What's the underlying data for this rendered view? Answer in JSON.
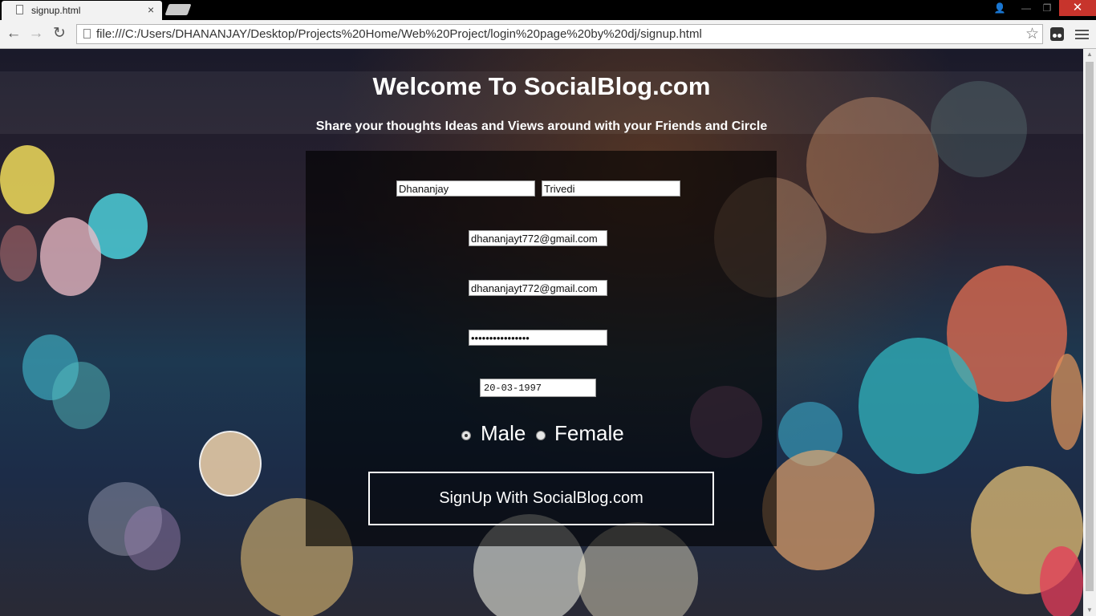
{
  "browser": {
    "tab_title": "signup.html",
    "tab_close": "×",
    "url": "file:///C:/Users/DHANANJAY/Desktop/Projects%20Home/Web%20Project/login%20page%20by%20dj/signup.html",
    "back": "←",
    "forward": "→",
    "reload": "↻",
    "star": "☆",
    "win_user": "👤",
    "win_min": "—",
    "win_max": "❐",
    "win_close": "✕"
  },
  "page": {
    "welcome": "Welcome To SocialBlog.com",
    "subtitle": "Share your thoughts Ideas and Views around with your Friends and Circle",
    "form": {
      "first_name": "Dhananjay",
      "last_name": "Trivedi",
      "email": "dhananjayt772@gmail.com",
      "email_confirm": "dhananjayt772@gmail.com",
      "password": "••••••••••••••••",
      "dob": "20-03-1997",
      "gender_options": [
        "Male",
        "Female"
      ],
      "gender_selected": "Male",
      "submit_label": "SignUp With SocialBlog.com"
    }
  }
}
